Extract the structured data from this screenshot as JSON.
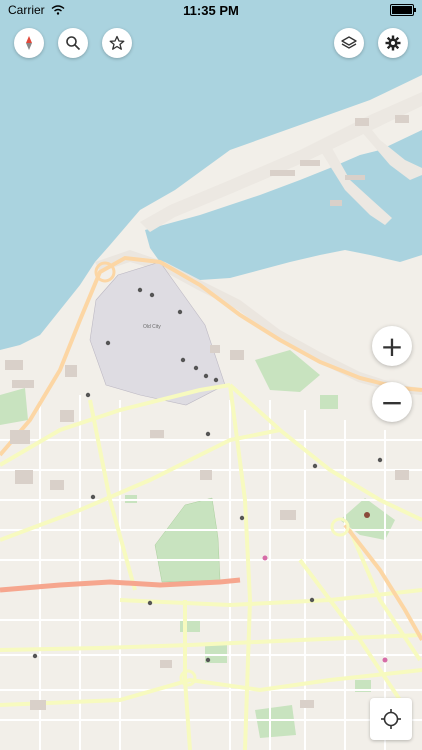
{
  "status_bar": {
    "carrier": "Carrier",
    "time": "11:35 PM",
    "battery_percent": 100
  },
  "toolbar": {
    "left_icons": [
      "compass-icon",
      "search-icon",
      "star-icon"
    ],
    "right_icons": [
      "layers-icon",
      "gear-icon"
    ]
  },
  "map": {
    "labels": {
      "old_city": "Old City"
    },
    "colors": {
      "sea": "#aad3df",
      "land": "#f2efe9",
      "old_city": "#dedce2",
      "park": "#c8e3bf",
      "main_road": "#f7fabf",
      "primary_road": "#fcd6a4",
      "trunk_road": "#f6a68e"
    }
  },
  "zoom": {
    "in_label": "+",
    "out_label": "−"
  },
  "locate": {
    "icon": "crosshair-icon"
  }
}
